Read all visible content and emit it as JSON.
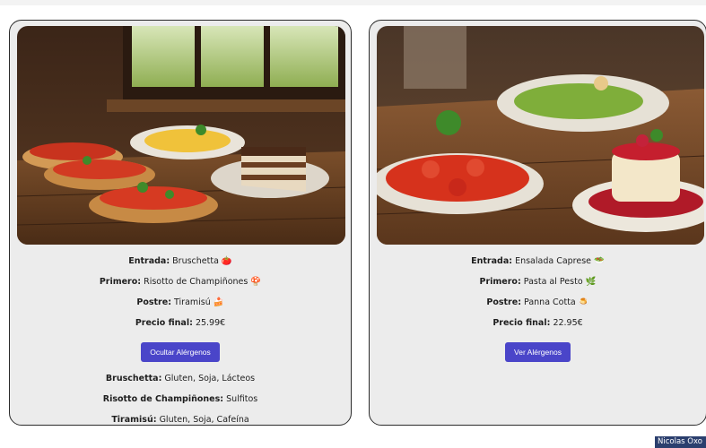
{
  "menus": [
    {
      "entrada_label": "Entrada:",
      "entrada_value": "Bruschetta 🍅",
      "primero_label": "Primero:",
      "primero_value": "Risotto de Champiñones 🍄",
      "postre_label": "Postre:",
      "postre_value": "Tiramisú 🍰",
      "precio_label": "Precio final:",
      "precio_value": "25.99€",
      "button_label": "Ocultar Alérgenos",
      "allergens": [
        {
          "dish": "Bruschetta:",
          "list": "Gluten, Soja, Lácteos"
        },
        {
          "dish": "Risotto de Champiñones:",
          "list": "Sulfitos"
        },
        {
          "dish": "Tiramisú:",
          "list": "Gluten, Soja, Cafeína"
        }
      ]
    },
    {
      "entrada_label": "Entrada:",
      "entrada_value": "Ensalada Caprese 🥗",
      "primero_label": "Primero:",
      "primero_value": "Pasta al Pesto 🌿",
      "postre_label": "Postre:",
      "postre_value": "Panna Cotta 🍮",
      "precio_label": "Precio final:",
      "precio_value": "22.95€",
      "button_label": "Ver Alérgenos"
    }
  ],
  "user_chip": "Nicolas Oxo"
}
